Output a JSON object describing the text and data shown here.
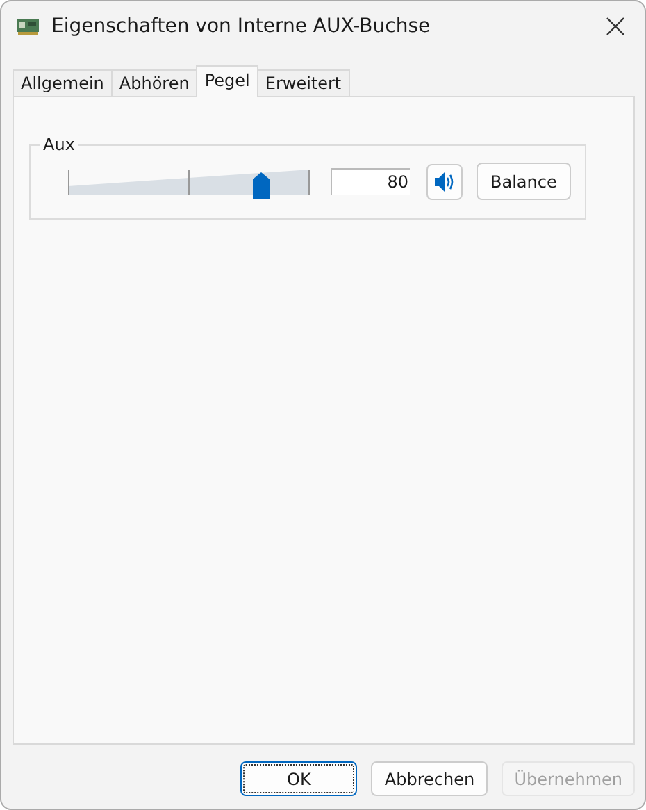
{
  "window": {
    "title": "Eigenschaften von Interne AUX-Buchse"
  },
  "tabs": [
    {
      "label": "Allgemein",
      "selected": false
    },
    {
      "label": "Abhören",
      "selected": false
    },
    {
      "label": "Pegel",
      "selected": true
    },
    {
      "label": "Erweitert",
      "selected": false
    }
  ],
  "level_group": {
    "label": "Aux",
    "level": 0.8,
    "value": "80",
    "muted": false,
    "balance_button": "Balance"
  },
  "buttons": [
    {
      "label": "OK",
      "default": true,
      "disabled": false
    },
    {
      "label": "Abbrechen",
      "default": false,
      "disabled": false
    },
    {
      "label": "Übernehmen",
      "default": false,
      "disabled": true
    }
  ]
}
